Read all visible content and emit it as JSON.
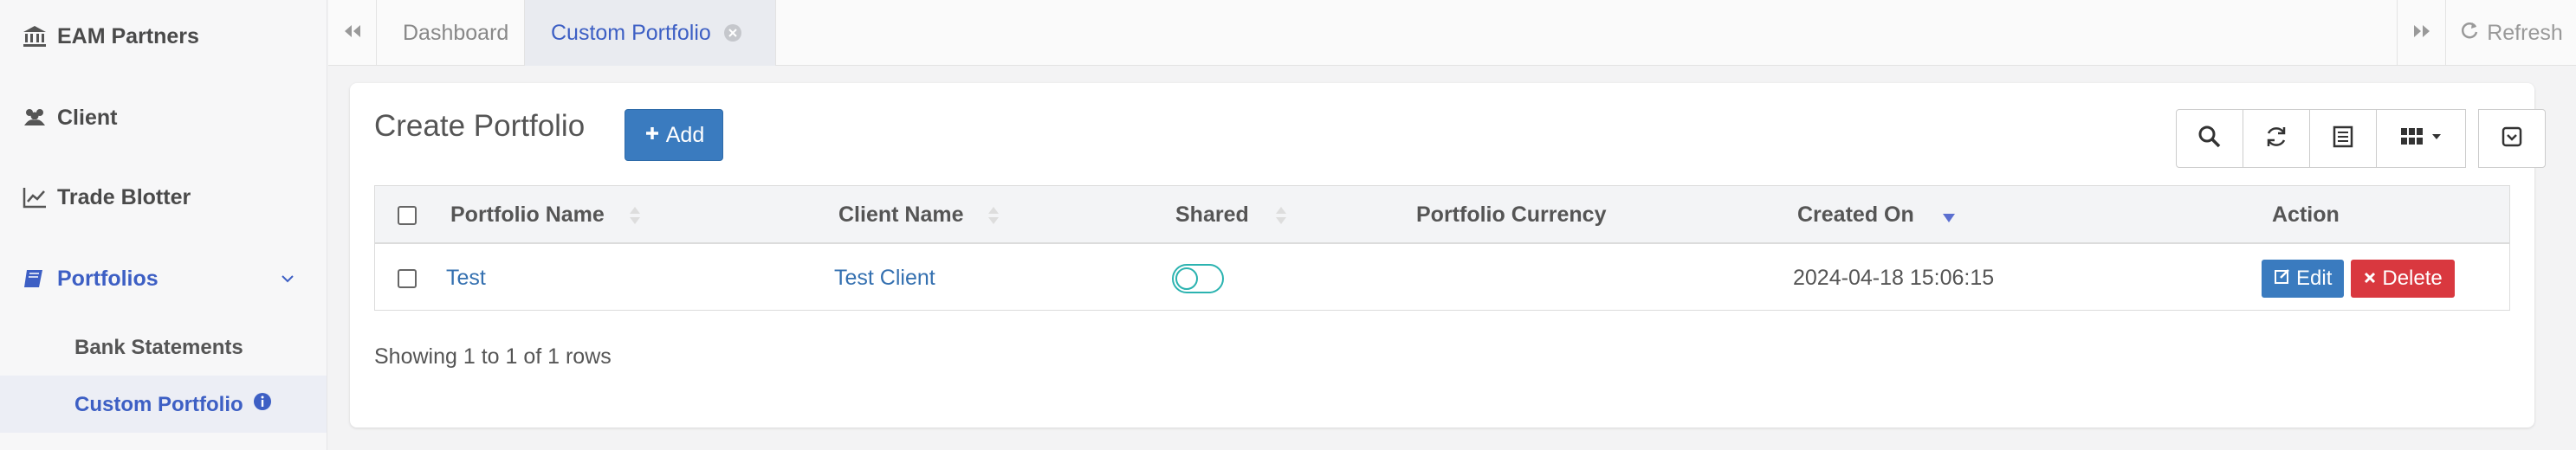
{
  "sidebar": {
    "items": [
      {
        "label": "EAM Partners",
        "icon": "bank-icon"
      },
      {
        "label": "Client",
        "icon": "users-icon"
      },
      {
        "label": "Trade Blotter",
        "icon": "line-chart-icon"
      },
      {
        "label": "Portfolios",
        "icon": "book-icon"
      }
    ],
    "sub_items": [
      {
        "label": "Bank Statements"
      },
      {
        "label": "Custom Portfolio",
        "icon": "info-icon"
      }
    ]
  },
  "tabs": {
    "items": [
      {
        "label": "Dashboard"
      },
      {
        "label": "Custom Portfolio"
      }
    ],
    "refresh_label": "Refresh"
  },
  "card": {
    "title": "Create Portfolio",
    "add_label": "Add"
  },
  "table": {
    "columns": [
      "Portfolio Name",
      "Client Name",
      "Shared",
      "Portfolio Currency",
      "Created On",
      "Action"
    ],
    "rows": [
      {
        "portfolio_name": "Test",
        "client_name": "Test Client",
        "shared": false,
        "portfolio_currency": "",
        "created_on": "2024-04-18 15:06:15",
        "edit_label": "Edit",
        "delete_label": "Delete"
      }
    ],
    "footer": "Showing 1 to 1 of 1 rows"
  },
  "colors": {
    "accent": "#3d5fc4",
    "primary_button": "#3a7bbf",
    "danger_button": "#d9383f",
    "toggle": "#2bb3b0"
  }
}
